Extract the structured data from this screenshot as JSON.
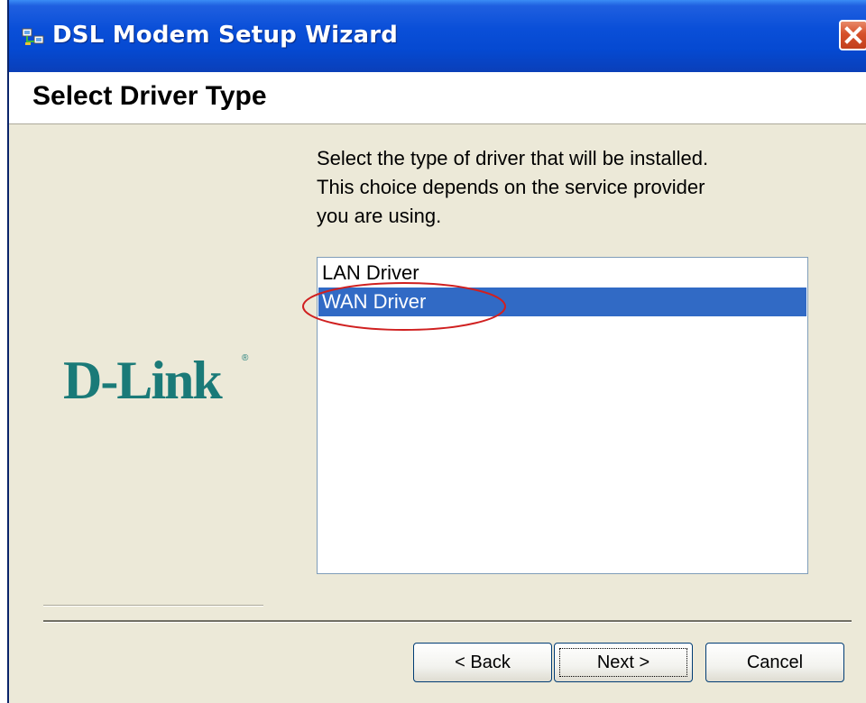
{
  "window": {
    "title": "DSL Modem Setup Wizard",
    "close_icon": "close-icon"
  },
  "header": {
    "title": "Select Driver Type"
  },
  "logo": {
    "text": "D-Link",
    "registered_mark": "®"
  },
  "instructions": {
    "lines": [
      "Select the type of driver that will be installed.",
      "This choice depends on the service provider",
      "you are using."
    ]
  },
  "driver_list": {
    "items": [
      "LAN Driver",
      "WAN Driver"
    ],
    "selected": "WAN Driver"
  },
  "buttons": {
    "back_label": "< Back",
    "next_label": "Next >",
    "cancel_label": "Cancel"
  },
  "colors": {
    "title_bar": "#0a4fd8",
    "selection": "#316ac5",
    "logo": "#1a7a78",
    "annotation": "#d02020",
    "close_button": "#d6502a"
  }
}
